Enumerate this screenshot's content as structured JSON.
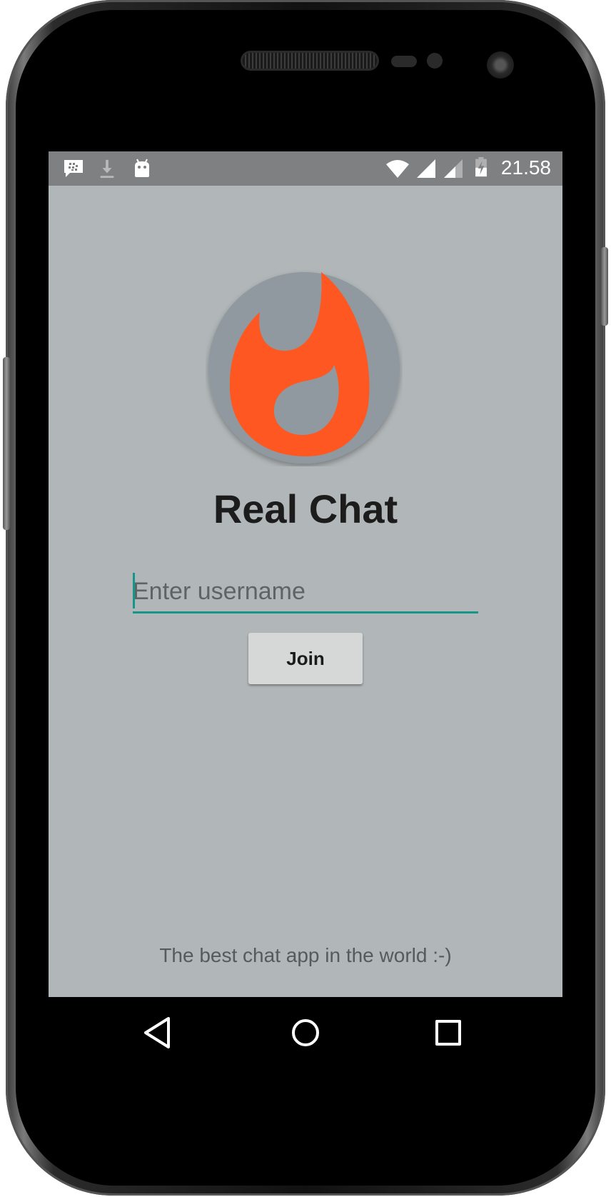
{
  "status_bar": {
    "icons": [
      "bbm-icon",
      "download-icon",
      "android-icon",
      "wifi-icon",
      "cell-signal-icon",
      "cell-signal-2-icon",
      "battery-charging-icon"
    ],
    "time": "21.58"
  },
  "app": {
    "logo_icon": "flame-logo-icon",
    "title": "Real Chat",
    "username_placeholder": "Enter username",
    "username_value": "",
    "join_label": "Join",
    "tagline": "The best chat app in the world :-)",
    "accent_color": "#14968a",
    "logo_flame_color": "#fe5722",
    "logo_bg_color": "#8f999f",
    "background_color": "#b1b6b8"
  },
  "nav_bar": {
    "buttons": [
      "back-icon",
      "home-icon",
      "recents-icon"
    ]
  }
}
